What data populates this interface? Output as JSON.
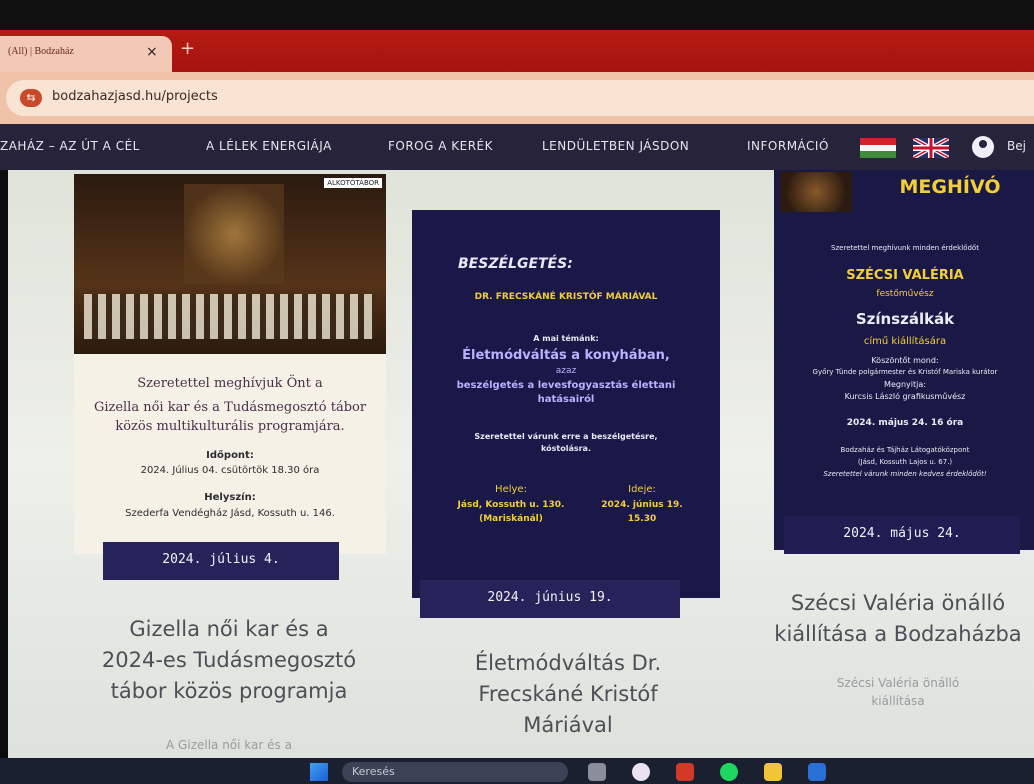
{
  "browser": {
    "tab_title": "(All) | Bodzaház",
    "tab_close": "×",
    "new_tab": "+",
    "url": "bodzahazjasd.hu/projects",
    "site_icon": "⇆"
  },
  "nav": {
    "items": [
      "ZAHÁZ – AZ ÚT A CÉL",
      "A LÉLEK ENERGIÁJA",
      "FOROG A KERÉK",
      "LENDÜLETBEN JÁSDON",
      "INFORMÁCIÓ"
    ],
    "login": "Bej"
  },
  "cards": [
    {
      "poster": {
        "camp_label": "ALKOTÓTÁBOR",
        "invite_l1": "Szeretettel meghívjuk Önt a",
        "invite_l2": "Gizella női kar és a Tudásmegosztó tábor",
        "invite_l3": "közös multikulturális programjára.",
        "time_label": "Időpont:",
        "time_value": "2024. Július 04. csütörtök 18.30 óra",
        "place_label": "Helyszín:",
        "place_value": "Szederfa Vendégház Jásd, Kossuth u. 146."
      },
      "date": "2024. július 4.",
      "title_lines": [
        "Gizella női kar és a",
        "2024-es Tudásmegosztó",
        "tábor közös programja"
      ],
      "excerpt": "A Gizella női kar és a"
    },
    {
      "poster": {
        "heading": "BESZÉLGETÉS:",
        "guest": "DR. FRECSKÁNÉ KRISTÓF MÁRIÁVAL",
        "topic_label": "A mai témánk:",
        "topic_main": "Életmódváltás a konyhában,",
        "topic_or": "azaz",
        "topic_sub_l1": "beszélgetés a levesfogyasztás élettani",
        "topic_sub_l2": "hatásairól",
        "welcome_l1": "Szeretettel várunk erre a beszélgetésre,",
        "welcome_l2": "kóstolásra.",
        "place_label": "Helye:",
        "place_l1": "Jásd, Kossuth u. 130.",
        "place_l2": "(Mariskánál)",
        "time_label": "Ideje:",
        "time_l1": "2024. június 19.",
        "time_l2": "15.30"
      },
      "date": "2024. június 19.",
      "title_lines": [
        "Életmódváltás Dr.",
        "Frecskáné Kristóf",
        "Máriával"
      ]
    },
    {
      "poster": {
        "heading": "MEGHÍVÓ",
        "invite": "Szeretettel meghívunk minden érdeklődőt",
        "artist": "SZÉCSI VALÉRIA",
        "role": "festőművész",
        "show": "Színszálkák",
        "show_sub": "című kiállítására",
        "greet_label": "Köszöntőt mond:",
        "greeters": "Győry Tünde polgármester és Kristóf Mariska kurátor",
        "opener_label": "Megnyitja:",
        "opener": "Kurcsis László grafikusművész",
        "datetime": "2024. május 24. 16 óra",
        "venue_l1": "Bodzaház és Tájház Látogatóközpont",
        "venue_l2": "(Jásd, Kossuth Lajos u. 67.)",
        "closing": "Szeretettel várunk minden kedves érdeklődőt!"
      },
      "date": "2024. május 24.",
      "title_lines": [
        "Szécsi Valéria önálló",
        "kiállítása a Bodzaházba"
      ],
      "excerpt_lines": [
        "Szécsi Valéria önálló",
        "kiállítása"
      ]
    }
  ],
  "taskbar": {
    "search_placeholder": "Keresés"
  },
  "colors": {
    "tab_strip": "#b51c12",
    "nav_bg": "#26233a",
    "poster_navy": "#1a1848",
    "date_bar": "#26235a",
    "accent_yellow": "#f2cf3a"
  }
}
